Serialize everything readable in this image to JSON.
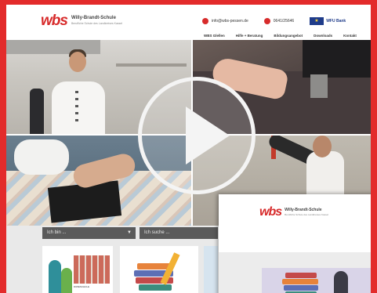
{
  "header": {
    "logo_mark": "wbs",
    "logo_name": "Willy-Brandt-Schule",
    "logo_sub": "Berufliche Schule des Landkreises Kassel",
    "email": "info@wbs-pessen.de",
    "phone": "0641/25646",
    "eu_label": "WFU Bank"
  },
  "nav": {
    "items": [
      "WBS Glellen",
      "Hilfe + Beratung",
      "Bildungsangebot",
      "Downloads",
      "Kontakt"
    ]
  },
  "filters": {
    "select1": "Ich bin ...",
    "select2": "Ich suche ..."
  },
  "cards": {
    "card1_caption": "DIWESCHULE"
  },
  "overlay": {
    "logo_mark": "wbs",
    "logo_name": "Willy-Brandt-Schule",
    "logo_sub": "Berufliche Schule des Landkreises Kassel"
  },
  "colors": {
    "brand": "#e32b2b",
    "dark_select": "#5a5a5a"
  }
}
